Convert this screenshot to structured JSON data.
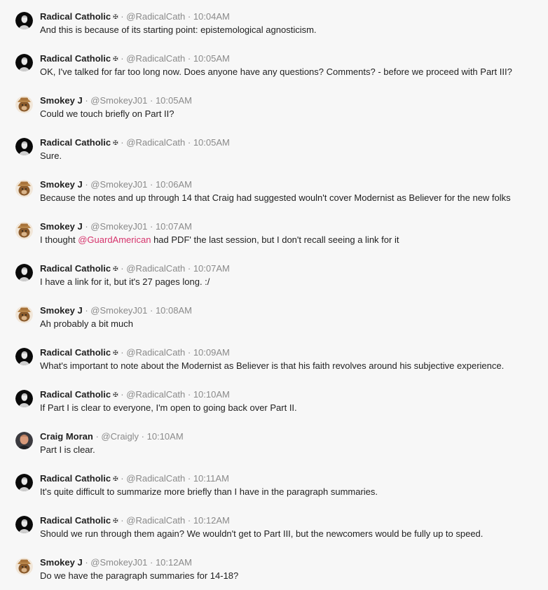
{
  "messages": [
    {
      "avatar": "radical-catholic-avatar",
      "name": "Radical Catholic",
      "badge": "✠",
      "handle": "@RadicalCath",
      "time": "10:04AM",
      "text": "And this is because of its starting point: epistemological agnosticism."
    },
    {
      "avatar": "radical-catholic-avatar",
      "name": "Radical Catholic",
      "badge": "✠",
      "handle": "@RadicalCath",
      "time": "10:05AM",
      "text": "OK, I've talked for far too long now. Does anyone have any questions? Comments? - before we proceed with Part III?"
    },
    {
      "avatar": "smokey-avatar",
      "name": "Smokey J",
      "badge": "",
      "handle": "@SmokeyJ01",
      "time": "10:05AM",
      "text": "Could we touch briefly on Part II?"
    },
    {
      "avatar": "radical-catholic-avatar",
      "name": "Radical Catholic",
      "badge": "✠",
      "handle": "@RadicalCath",
      "time": "10:05AM",
      "text": "Sure."
    },
    {
      "avatar": "smokey-avatar",
      "name": "Smokey J",
      "badge": "",
      "handle": "@SmokeyJ01",
      "time": "10:06AM",
      "text": "Because the notes and up through 14 that Craig had suggested wouln't cover Modernist as Believer for the new folks"
    },
    {
      "avatar": "smokey-avatar",
      "name": "Smokey J",
      "badge": "",
      "handle": "@SmokeyJ01",
      "time": "10:07AM",
      "text_before": "I thought ",
      "mention": "@GuardAmerican",
      "text_after": " had PDF' the last session, but I don't recall seeing a link for it"
    },
    {
      "avatar": "radical-catholic-avatar",
      "name": "Radical Catholic",
      "badge": "✠",
      "handle": "@RadicalCath",
      "time": "10:07AM",
      "text": "I have a link for it, but it's 27 pages long. :/"
    },
    {
      "avatar": "smokey-avatar",
      "name": "Smokey J",
      "badge": "",
      "handle": "@SmokeyJ01",
      "time": "10:08AM",
      "text": "Ah probably a bit much"
    },
    {
      "avatar": "radical-catholic-avatar",
      "name": "Radical Catholic",
      "badge": "✠",
      "handle": "@RadicalCath",
      "time": "10:09AM",
      "text": "What's important to note about the Modernist as Believer is that his faith revolves around his subjective experience."
    },
    {
      "avatar": "radical-catholic-avatar",
      "name": "Radical Catholic",
      "badge": "✠",
      "handle": "@RadicalCath",
      "time": "10:10AM",
      "text": "If Part I is clear to everyone, I'm open to going back over Part II."
    },
    {
      "avatar": "craig-avatar",
      "name": "Craig Moran",
      "badge": "",
      "handle": "@Craigly",
      "time": "10:10AM",
      "text": "Part I is clear."
    },
    {
      "avatar": "radical-catholic-avatar",
      "name": "Radical Catholic",
      "badge": "✠",
      "handle": "@RadicalCath",
      "time": "10:11AM",
      "text": "It's quite difficult to summarize more briefly than I have in the paragraph summaries."
    },
    {
      "avatar": "radical-catholic-avatar",
      "name": "Radical Catholic",
      "badge": "✠",
      "handle": "@RadicalCath",
      "time": "10:12AM",
      "text": "Should we run through them again? We wouldn't get to Part III, but the newcomers would be fully up to speed."
    },
    {
      "avatar": "smokey-avatar",
      "name": "Smokey J",
      "badge": "",
      "handle": "@SmokeyJ01",
      "time": "10:12AM",
      "text": "Do we have the paragraph summaries for 14-18?"
    }
  ],
  "separator": " · ",
  "colors": {
    "background": "#f7f7f7",
    "name": "#1f1f1f",
    "meta": "#8a8a8a",
    "mention": "#d6336c"
  }
}
